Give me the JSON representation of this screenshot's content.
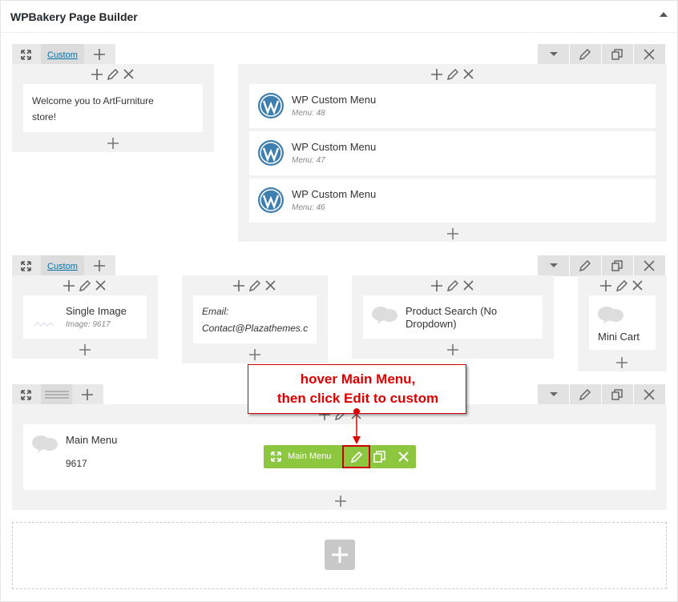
{
  "panel": {
    "title": "WPBakery Page Builder"
  },
  "row1": {
    "tab_label": "Custom",
    "col1": {
      "text_line1": "Welcome you to ArtFurniture",
      "text_line2": "store!"
    },
    "col2": {
      "elements": [
        {
          "title": "WP Custom Menu",
          "sub": "Menu: 48"
        },
        {
          "title": "WP Custom Menu",
          "sub": "Menu: 47"
        },
        {
          "title": "WP Custom Menu",
          "sub": "Menu: 46"
        }
      ]
    }
  },
  "row2": {
    "tab_label": "Custom",
    "col1": {
      "title": "Single Image",
      "sub": "Image: 9617"
    },
    "col2": {
      "line1": "Email:",
      "line2": "Contact@Plazathemes.c"
    },
    "col3": {
      "title_line1": "Product Search (No",
      "title_line2": "Dropdown)"
    },
    "col4": {
      "title": "Mini Cart"
    }
  },
  "row3": {
    "element": {
      "title": "Main Menu",
      "value": "9617"
    },
    "hover_bar": {
      "label": "Main Menu"
    }
  },
  "annotation": {
    "line1": "hover Main Menu,",
    "line2": "then click Edit to custom"
  },
  "colors": {
    "accent_green": "#8dc63f",
    "annotation_red": "#dd0000",
    "wp_blue": "#3e7fb0"
  }
}
